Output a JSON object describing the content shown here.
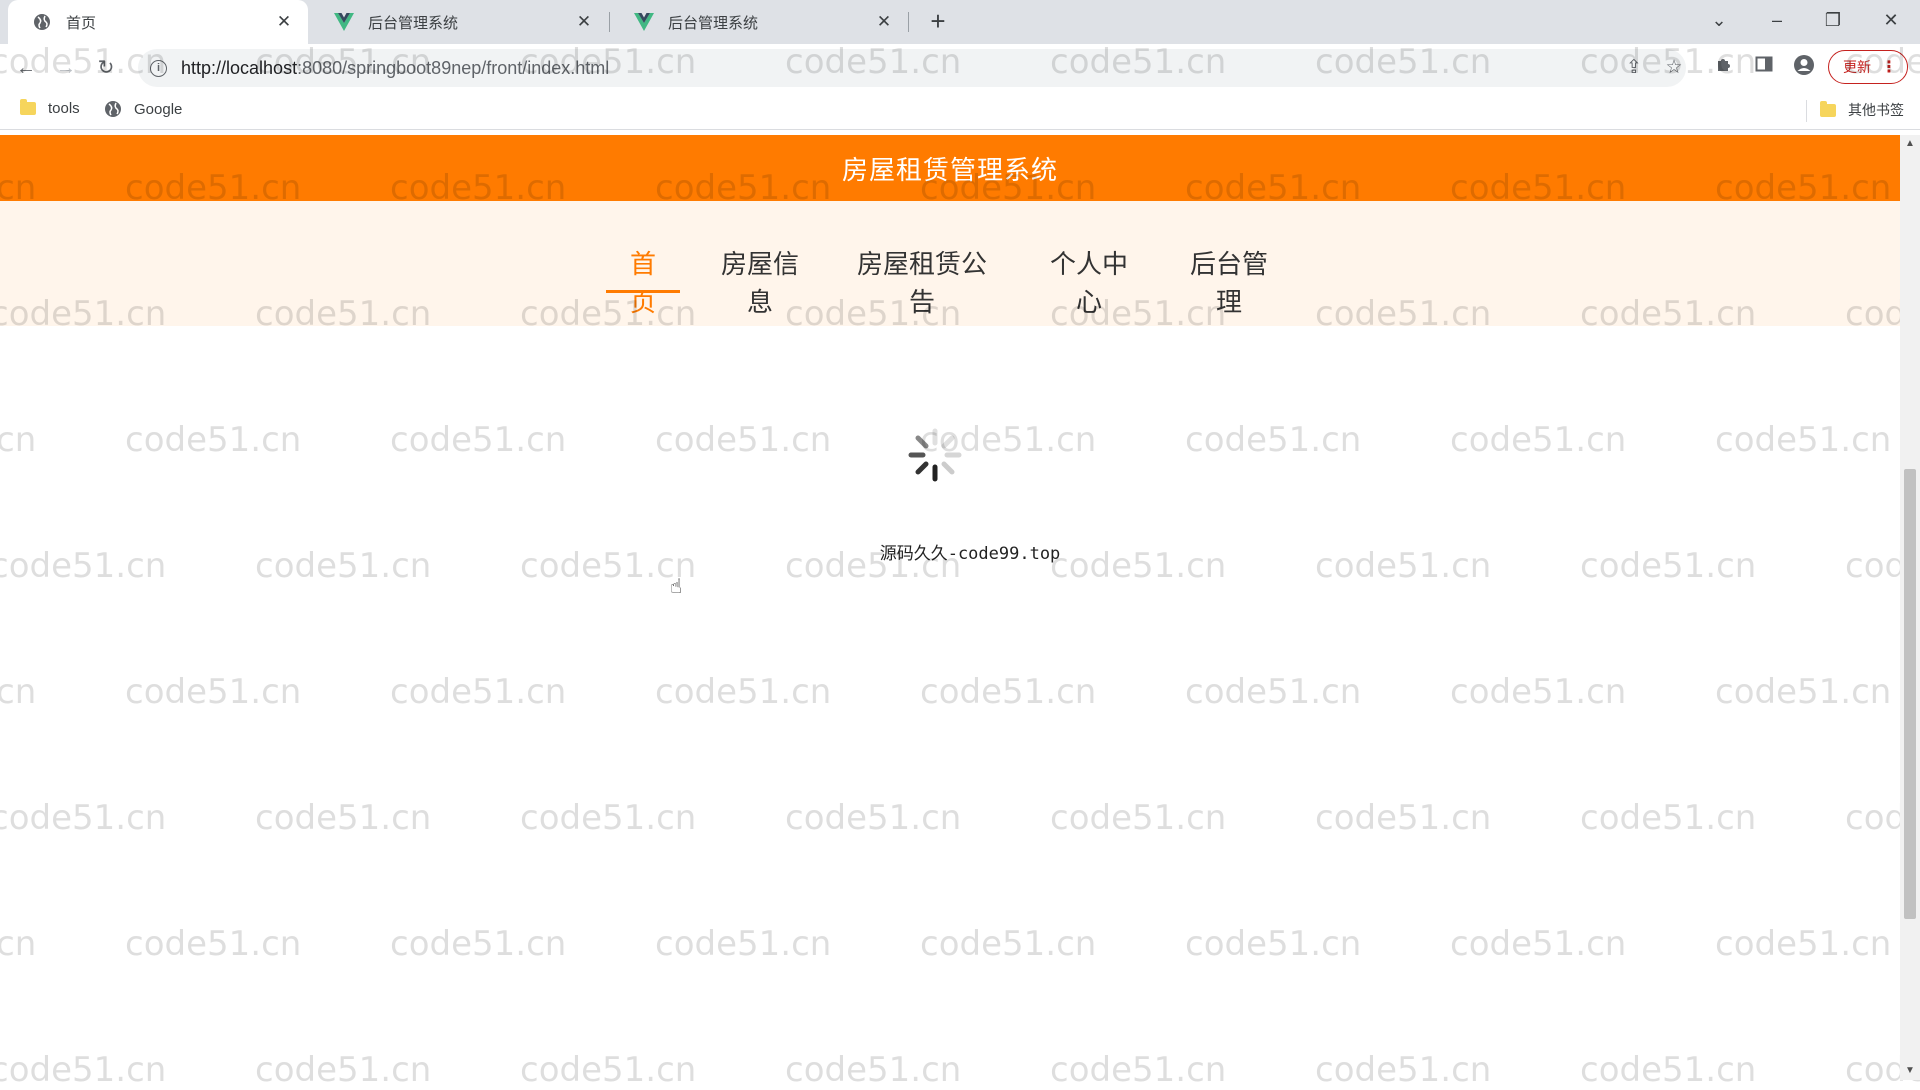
{
  "browser": {
    "tabs": [
      {
        "title": "首页",
        "icon": "globe-icon",
        "active": true
      },
      {
        "title": "后台管理系统",
        "icon": "vue-logo-icon",
        "active": false
      },
      {
        "title": "后台管理系统",
        "icon": "vue-logo-icon",
        "active": false
      }
    ],
    "new_tab": "+",
    "url": {
      "host": "http://localhost",
      "path": ":8080/springboot89nep/front/index.html"
    },
    "update_label": "更新",
    "bookmarks": [
      {
        "label": "tools",
        "icon": "folder-icon"
      },
      {
        "label": "Google",
        "icon": "globe-icon"
      }
    ],
    "other_bookmarks": "其他书签"
  },
  "site": {
    "title": "房屋租赁管理系统",
    "nav": [
      {
        "label": "首页",
        "active": true
      },
      {
        "label": "房屋信息",
        "active": false
      },
      {
        "label": "房屋租赁公告",
        "active": false
      },
      {
        "label": "个人中心",
        "active": false
      },
      {
        "label": "后台管理",
        "active": false
      }
    ],
    "loading_text": "源码久久-code99.top",
    "accent_color": "#ff7b00",
    "nav_background": "#fff5eb"
  },
  "watermark_text": "code51.cn"
}
